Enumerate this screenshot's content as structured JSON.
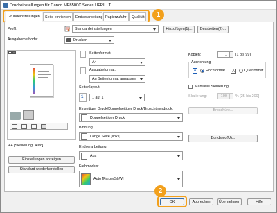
{
  "window": {
    "title": "Druckeinstellungen für Canon MF8500C Series UFRII LT"
  },
  "tabs": [
    "Grundeinstellungen",
    "Seite einrichten",
    "Endverarbeitung",
    "Papierzufuhr",
    "Qualität"
  ],
  "callouts": [
    "1",
    "2"
  ],
  "profile": {
    "label": "Profil:",
    "value": "Standardeinstellungen",
    "add_button": "Hinzufügen(1)...",
    "edit_button": "Bearbeiten(2)..."
  },
  "output": {
    "label": "Ausgabemethode:",
    "value": "Drucken"
  },
  "preview": {
    "caption": "A4 [Skalierung: Auto]",
    "show_settings_button": "Einstellungen anzeigen",
    "restore_defaults_button": "Standard wiederherstellen"
  },
  "page_format": {
    "label": "Seitenformat:",
    "value": "A4"
  },
  "output_format": {
    "label": "Ausgabeformat:",
    "value": "An Seitenformat anpassen"
  },
  "copies": {
    "label": "Kopien:",
    "value": "1",
    "range": "[1 bis 99]"
  },
  "orientation": {
    "label": "Ausrichtung",
    "portrait": "Hochformat",
    "landscape": "Querformat"
  },
  "manual_scaling": {
    "label": "Manuelle Skalierung",
    "scale_label": "Skalierung:",
    "value": "100",
    "range": "% [25 bis 200]"
  },
  "layout": {
    "label": "Seitenlayout:",
    "value": "1 auf 1"
  },
  "duplex": {
    "label": "Einseitiger Druck/Doppelseitiger Druck/Broschürendruck:",
    "value": "Doppelseitiger Druck"
  },
  "booklet_button": "Broschüre...",
  "binding": {
    "label": "Bindung:",
    "value": "Lange Seite [links]"
  },
  "binding_position_button": "Bundsteg(U)...",
  "finishing": {
    "label": "Endverarbeitung:",
    "value": "Aus"
  },
  "color_mode": {
    "label": "Farbmodus:",
    "value": "Auto [Farbe/S&W]"
  },
  "footer": {
    "ok": "OK",
    "cancel": "Abbrechen",
    "apply": "Übernehmen",
    "help": "Hilfe"
  }
}
